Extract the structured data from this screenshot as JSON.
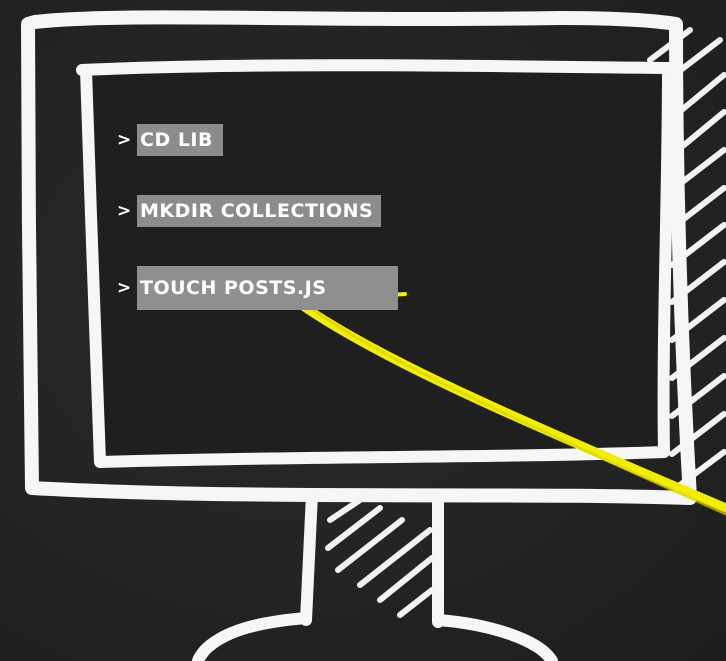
{
  "terminal": {
    "lines": [
      {
        "prompt": ">",
        "command": "cd lib"
      },
      {
        "prompt": ">",
        "command": "mkdir collections"
      },
      {
        "prompt": ">",
        "command": "touch posts.js"
      }
    ]
  },
  "colors": {
    "background": "#252525",
    "chalk": "#ffffff",
    "command_highlight": "#8c8c8c",
    "annotation": "#f2ee00"
  },
  "icons": {
    "monitor": "monitor-icon",
    "annotation_arrow": "arrow-annotation"
  }
}
